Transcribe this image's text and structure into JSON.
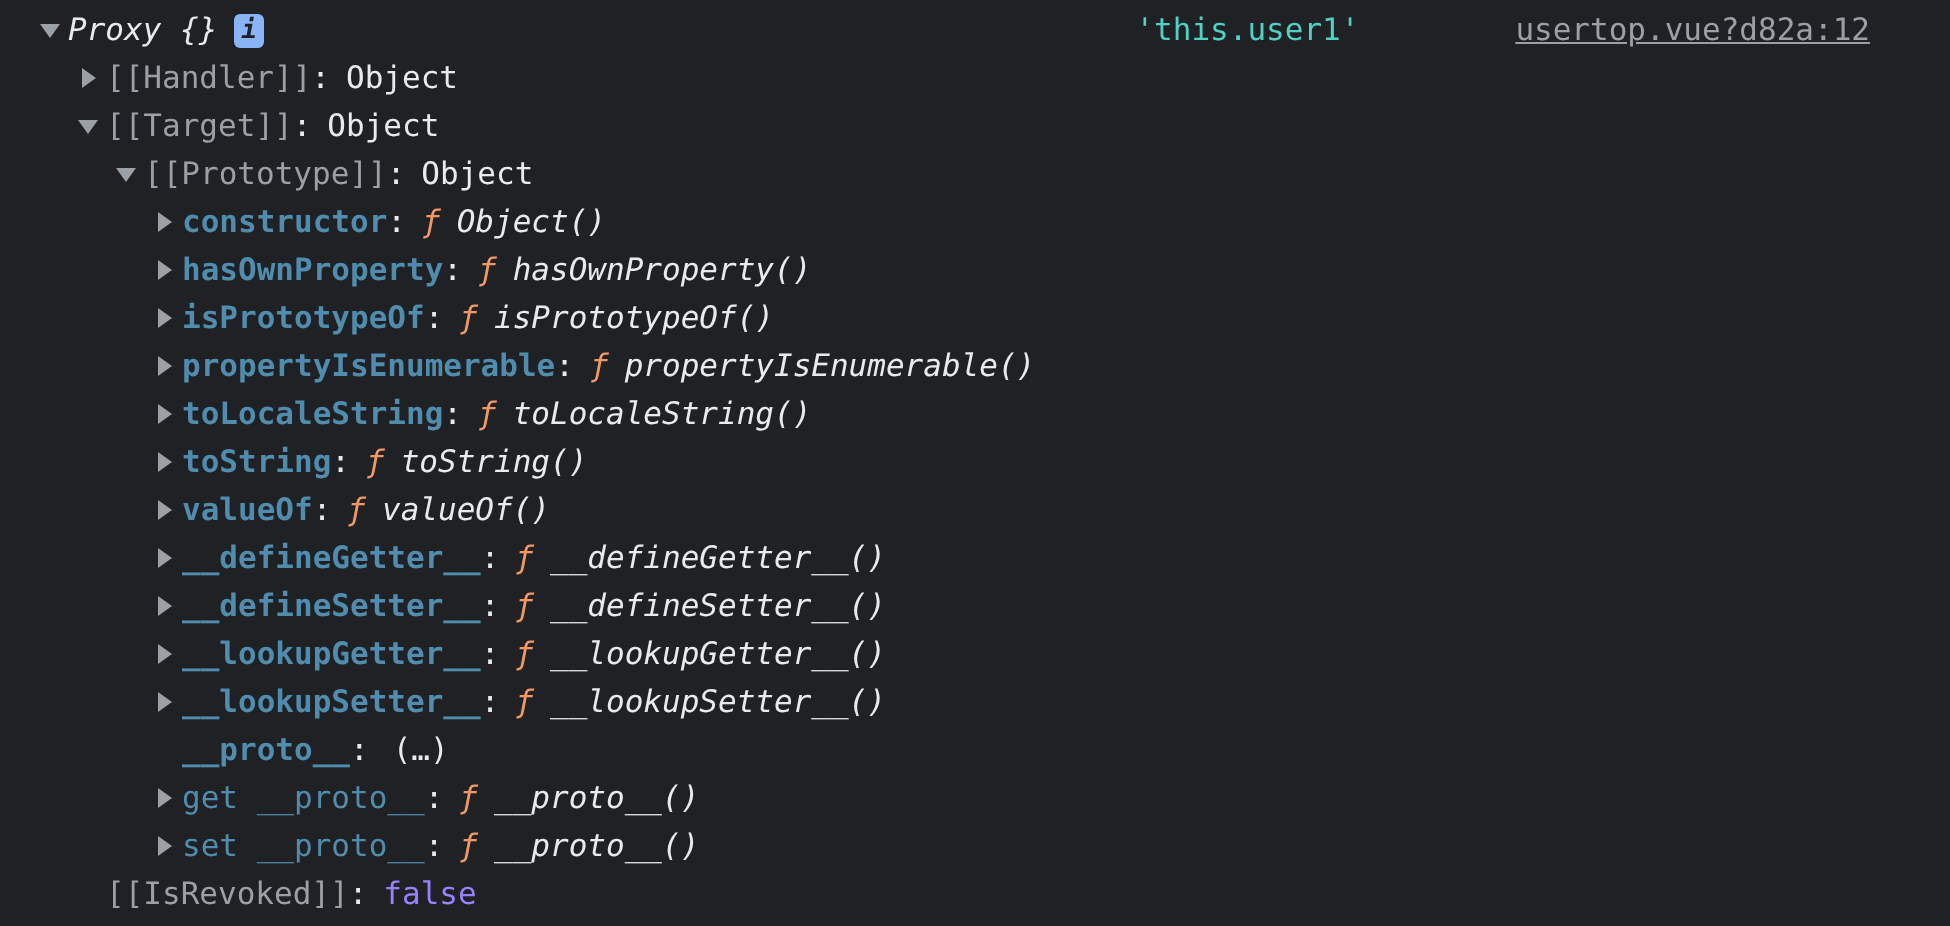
{
  "header": {
    "expanded": true,
    "label": "Proxy {}",
    "info": "i",
    "expression": "'this.user1'",
    "source": "usertop.vue?d82a:12"
  },
  "tree": [
    {
      "kind": "internal",
      "expanded": false,
      "key": "[[Handler]]",
      "separator": ":",
      "value": "Object"
    },
    {
      "kind": "internal",
      "expanded": true,
      "key": "[[Target]]",
      "separator": ":",
      "value": "Object",
      "children": [
        {
          "kind": "internal",
          "expanded": true,
          "key": "[[Prototype]]",
          "separator": ":",
          "value": "Object",
          "children": [
            {
              "kind": "method",
              "expanded": false,
              "key": "constructor",
              "separator": ":",
              "func_mark": "ƒ",
              "value": "Object()"
            },
            {
              "kind": "method",
              "expanded": false,
              "key": "hasOwnProperty",
              "separator": ":",
              "func_mark": "ƒ",
              "value": "hasOwnProperty()"
            },
            {
              "kind": "method",
              "expanded": false,
              "key": "isPrototypeOf",
              "separator": ":",
              "func_mark": "ƒ",
              "value": "isPrototypeOf()"
            },
            {
              "kind": "method",
              "expanded": false,
              "key": "propertyIsEnumerable",
              "separator": ":",
              "func_mark": "ƒ",
              "value": "propertyIsEnumerable()"
            },
            {
              "kind": "method",
              "expanded": false,
              "key": "toLocaleString",
              "separator": ":",
              "func_mark": "ƒ",
              "value": "toLocaleString()"
            },
            {
              "kind": "method",
              "expanded": false,
              "key": "toString",
              "separator": ":",
              "func_mark": "ƒ",
              "value": "toString()"
            },
            {
              "kind": "method",
              "expanded": false,
              "key": "valueOf",
              "separator": ":",
              "func_mark": "ƒ",
              "value": "valueOf()"
            },
            {
              "kind": "method",
              "expanded": false,
              "key": "__defineGetter__",
              "separator": ":",
              "func_mark": "ƒ",
              "value": "__defineGetter__()"
            },
            {
              "kind": "method",
              "expanded": false,
              "key": "__defineSetter__",
              "separator": ":",
              "func_mark": "ƒ",
              "value": "__defineSetter__()"
            },
            {
              "kind": "method",
              "expanded": false,
              "key": "__lookupGetter__",
              "separator": ":",
              "func_mark": "ƒ",
              "value": "__lookupGetter__()"
            },
            {
              "kind": "method",
              "expanded": false,
              "key": "__lookupSetter__",
              "separator": ":",
              "func_mark": "ƒ",
              "value": "__lookupSetter__()"
            },
            {
              "kind": "lazy",
              "key": "__proto__",
              "separator": ":",
              "value": "(…)"
            },
            {
              "kind": "accessor",
              "expanded": false,
              "key": "get __proto__",
              "separator": ":",
              "func_mark": "ƒ",
              "value": "__proto__()"
            },
            {
              "kind": "accessor",
              "expanded": false,
              "key": "set __proto__",
              "separator": ":",
              "func_mark": "ƒ",
              "value": "__proto__()"
            }
          ]
        }
      ]
    },
    {
      "kind": "boolean",
      "key": "[[IsRevoked]]",
      "separator": ":",
      "value": "false"
    }
  ]
}
